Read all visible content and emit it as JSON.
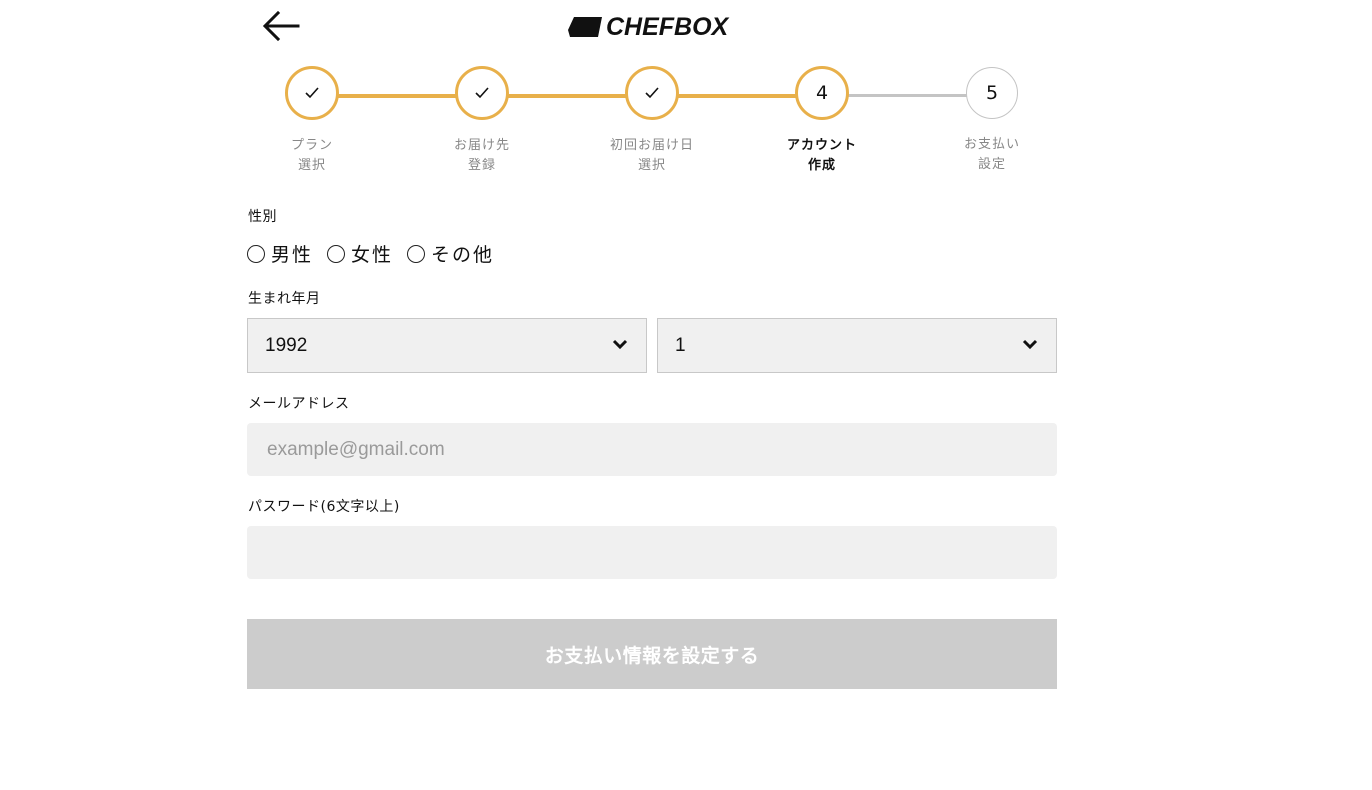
{
  "header": {
    "back_icon": "arrow-left-icon",
    "logo_text": "CHEFBOX"
  },
  "stepper": {
    "steps": [
      {
        "label_line1": "プラン",
        "label_line2": "選択",
        "state": "done",
        "number": ""
      },
      {
        "label_line1": "お届け先",
        "label_line2": "登録",
        "state": "done",
        "number": ""
      },
      {
        "label_line1": "初回お届け日",
        "label_line2": "選択",
        "state": "done",
        "number": ""
      },
      {
        "label_line1": "アカウント",
        "label_line2": "作成",
        "state": "active",
        "number": "4"
      },
      {
        "label_line1": "お支払い",
        "label_line2": "設定",
        "state": "pending",
        "number": "5"
      }
    ],
    "done_icon": "check-icon"
  },
  "form": {
    "gender_label": "性別",
    "gender_options": [
      "男性",
      "女性",
      "その他"
    ],
    "birth_label": "生まれ年月",
    "birth_year": "1992",
    "birth_month": "1",
    "email_label": "メールアドレス",
    "email_placeholder": "example@gmail.com",
    "email_value": "",
    "password_label": "パスワード(6文字以上)",
    "password_value": "",
    "submit_label": "お支払い情報を設定する"
  },
  "colors": {
    "accent": "#e8b04a",
    "pending_line": "#c4c4c4",
    "input_bg": "#f0f0f0",
    "button_disabled": "#cccccc"
  }
}
